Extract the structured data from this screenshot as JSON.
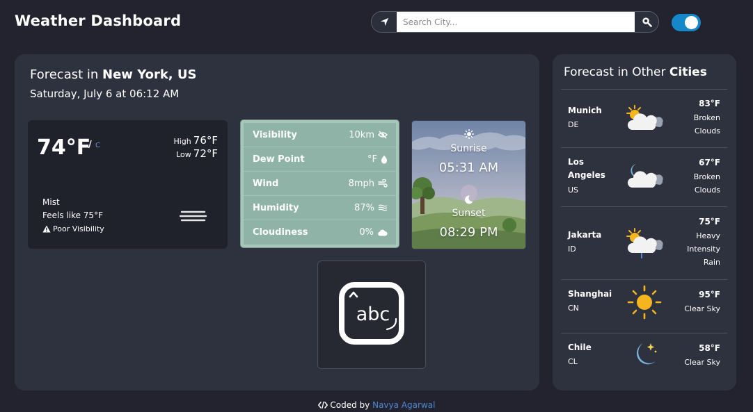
{
  "header": {
    "title": "Weather Dashboard",
    "search_placeholder": "Search City...",
    "locate_icon": "location-arrow-icon",
    "search_icon": "search-icon",
    "theme_toggle_on": true,
    "accent": "#1488c9"
  },
  "forecast": {
    "prefix": "Forecast in",
    "location": "New York, US",
    "datetime": "Saturday, July 6 at 06:12 AM",
    "current": {
      "temp": "74°F",
      "unit_sep": "/",
      "alt_unit": "C",
      "high_label": "High",
      "high": "76°F",
      "low_label": "Low",
      "low": "72°F",
      "condition": "Mist",
      "feels_like": "Feels like 75°F",
      "alert": "Poor Visibility"
    },
    "stats": [
      {
        "label": "Visibility",
        "value": "10km",
        "icon": "eye-slash-icon"
      },
      {
        "label": "Dew Point",
        "value": "°F",
        "icon": "droplet-icon"
      },
      {
        "label": "Wind",
        "value": "8mph",
        "icon": "wind-icon"
      },
      {
        "label": "Humidity",
        "value": "87%",
        "icon": "humidity-icon"
      },
      {
        "label": "Cloudiness",
        "value": "0%",
        "icon": "cloud-icon"
      }
    ],
    "sun": {
      "sunrise_label": "Sunrise",
      "sunrise_time": "05:31 AM",
      "sunset_label": "Sunset",
      "sunset_time": "08:29 PM"
    },
    "keyboard_icon_text": "abc"
  },
  "other_cities": {
    "prefix": "Forecast in Other",
    "highlight": "Cities",
    "items": [
      {
        "name": "Munich",
        "country": "DE",
        "temp": "83°F",
        "desc": "Broken Clouds",
        "icon": "sun-behind-clouds-icon"
      },
      {
        "name": "Los Angeles",
        "country": "US",
        "temp": "67°F",
        "desc": "Broken Clouds",
        "icon": "moon-behind-clouds-icon"
      },
      {
        "name": "Jakarta",
        "country": "ID",
        "temp": "75°F",
        "desc": "Heavy Intensity Rain",
        "icon": "sun-cloud-rain-icon"
      },
      {
        "name": "Shanghai",
        "country": "CN",
        "temp": "95°F",
        "desc": "Clear Sky",
        "icon": "sun-icon"
      },
      {
        "name": "Chile",
        "country": "CL",
        "temp": "58°F",
        "desc": "Clear Sky",
        "icon": "crescent-moon-icon"
      }
    ]
  },
  "footer": {
    "prefix": "Coded by",
    "author": "Navya Agarwal"
  }
}
